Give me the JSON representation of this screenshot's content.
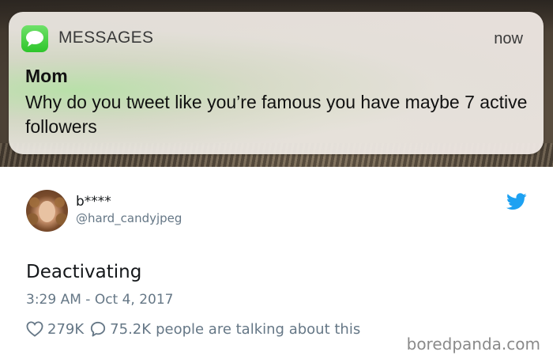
{
  "notification": {
    "app_name": "MESSAGES",
    "time": "now",
    "sender": "Mom",
    "body": "Why do you tweet like you’re famous you have maybe 7 active followers",
    "app_icon": "messages-bubble-icon",
    "accent_color": "#34c932"
  },
  "tweet": {
    "display_name": "b****",
    "handle": "@hard_candyjpeg",
    "text": "Deactivating",
    "timestamp": "3:29 AM - Oct 4, 2017",
    "likes": "279K",
    "replies": "75.2K",
    "talking_text": "people are talking about this",
    "brand_icon": "twitter-bird-icon",
    "brand_color": "#1da1f2"
  },
  "watermark": "boredpanda.com"
}
